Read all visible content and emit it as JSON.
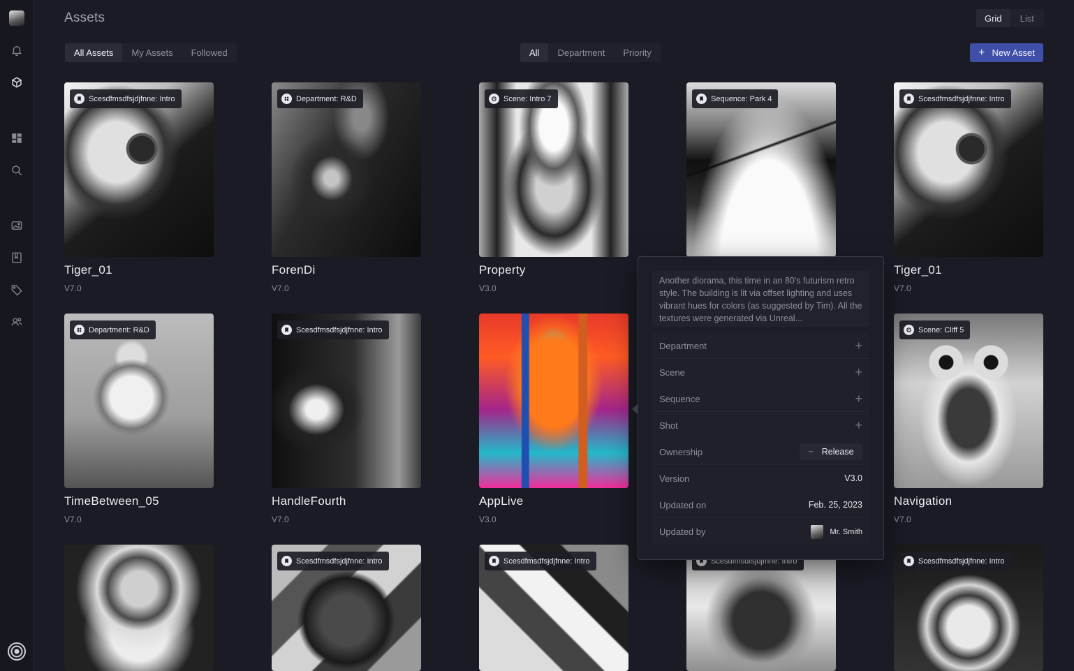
{
  "header": {
    "title": "Assets",
    "view_toggle": [
      "Grid",
      "List"
    ],
    "view_selected": "Grid",
    "filters_left": [
      "All Assets",
      "My Assets",
      "Followed"
    ],
    "filters_mid": [
      "All",
      "Department",
      "Priority"
    ],
    "new_asset_label": "New Asset"
  },
  "sidebar": {
    "icons": [
      "logo-icon",
      "bell-icon",
      "box-icon",
      "dashboard-icon",
      "search-icon",
      "image-icon",
      "board-icon",
      "tag-icon",
      "users-icon",
      "settings-icon"
    ]
  },
  "cards": [
    {
      "title": "Tiger_01",
      "version": "V7.0",
      "chip": "Scesdfmsdfsjdjfnne: Intro"
    },
    {
      "title": "ForenDi",
      "version": "V7.0",
      "chip": "Department: R&D"
    },
    {
      "title": "Property",
      "version": "V3.0",
      "chip": "Scene: Intro 7"
    },
    {
      "title": "",
      "version": "",
      "chip": "Sequence: Park 4"
    },
    {
      "title": "Tiger_01",
      "version": "V7.0",
      "chip": "Scesdfmsdfsjdjfnne: Intro"
    },
    {
      "title": "TimeBetween_05",
      "version": "V7.0",
      "chip": "Department: R&D"
    },
    {
      "title": "HandleFourth",
      "version": "V7.0",
      "chip": "Scesdfmsdfsjdjfnne: Intro"
    },
    {
      "title": "AppLive",
      "version": "V3.0",
      "chip": ""
    },
    {
      "title": "Navigation",
      "version": "V7.0",
      "chip": "Scene: Cliff 5"
    },
    {
      "title": "",
      "version": "",
      "chip": ""
    },
    {
      "title": "",
      "version": "",
      "chip": "Scesdfmsdfsjdjfnne: Intro"
    },
    {
      "title": "",
      "version": "",
      "chip": "Scesdfmsdfsjdjfnne: Intro"
    },
    {
      "title": "",
      "version": "",
      "chip": "Scesdfmsdfsjdjfnne: Intro"
    },
    {
      "title": "",
      "version": "",
      "chip": "Scesdfmsdfsjdjfnne: Intro"
    }
  ],
  "popover": {
    "description": "Another diorama, this time in an 80's futurism retro style. The building is lit via offset lighting and uses vibrant hues for colors (as suggested by Tim). All the textures were generated via Unreal...",
    "rows": [
      {
        "label": "Department"
      },
      {
        "label": "Scene"
      },
      {
        "label": "Sequence"
      },
      {
        "label": "Shot"
      }
    ],
    "ownership_label": "Ownership",
    "ownership_button": "Release",
    "version_label": "Version",
    "version_value": "V3.0",
    "updated_on_label": "Updated on",
    "updated_on_value": "Feb. 25, 2023",
    "updated_by_label": "Updated by",
    "updated_by_value": "Mr. Smith"
  },
  "colors": {
    "background": "#1a1b25",
    "accent": "#3f4fa8"
  }
}
